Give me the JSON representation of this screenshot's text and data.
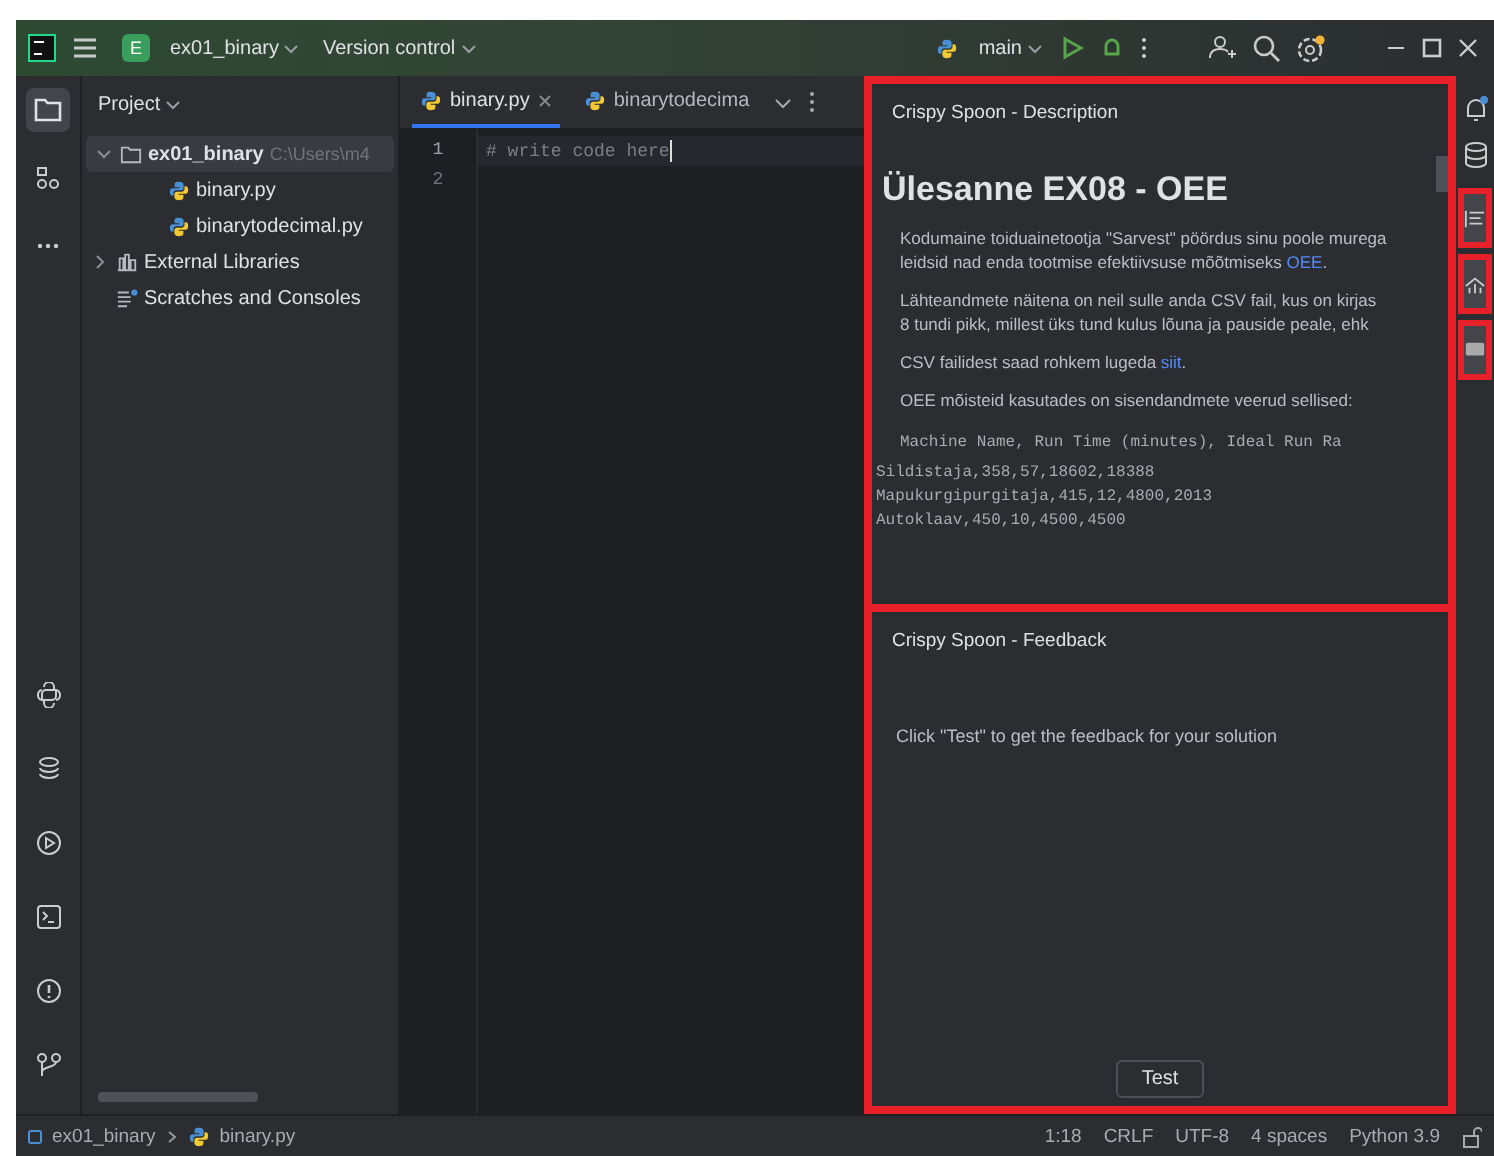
{
  "title_bar": {
    "project_badge": "E",
    "project": "ex01_binary",
    "vcs": "Version control",
    "branch": "main"
  },
  "project_panel": {
    "title": "Project",
    "tree": [
      {
        "label": "ex01_binary",
        "path": "C:\\Users\\m4",
        "kind": "folder",
        "expanded": true,
        "selected": true,
        "children": [
          {
            "label": "binary.py",
            "kind": "python",
            "selected": false
          },
          {
            "label": "binarytodecimal.py",
            "kind": "python",
            "selected": false
          }
        ]
      },
      {
        "label": "External Libraries",
        "kind": "library",
        "expanded": false,
        "selected": false
      },
      {
        "label": "Scratches and Consoles",
        "kind": "scratch",
        "selected": false
      }
    ]
  },
  "editor": {
    "tabs": [
      {
        "label": "binary.py",
        "selected": true
      },
      {
        "label": "binarytodecima",
        "selected": false
      }
    ],
    "lines": [
      {
        "number": "1",
        "code": "# write code here"
      },
      {
        "number": "2"
      }
    ]
  },
  "description": {
    "title": "Crispy Spoon - Description",
    "heading": "Ülesanne EX08 - OEE",
    "paragraphs": [
      [
        {
          "text": "Kodumaine toiduainetootja \"Sarvest\" pöördus sinu poole murega"
        },
        {
          "text": "leidsid nad enda tootmise efektiivsuse mõõtmiseks ",
          "link": "OEE",
          "after": "."
        }
      ],
      [
        {
          "text": "Lähteandmete näitena on neil sulle anda CSV fail, kus on kirjas"
        },
        {
          "text": "8 tundi pikk, millest üks tund kulus lõuna ja pauside peale, ehk"
        }
      ],
      [
        {
          "text": "CSV failidest saad rohkem lugeda ",
          "link": "siit",
          "after": "."
        }
      ],
      [
        {
          "text": "OEE mõisteid kasutades on sisendandmete veerud sellised:"
        }
      ]
    ],
    "code_header": "Machine Name, Run Time (minutes), Ideal Run Ra",
    "code_rows": [
      "Sildistaja,358,57,18602,18388",
      "Mapukurgipurgitaja,415,12,4800,2013",
      "Autoklaav,450,10,4500,4500"
    ]
  },
  "feedback": {
    "title": "Crispy Spoon - Feedback",
    "message": "Click \"Test\" to get the feedback for your solution",
    "button": "Test"
  },
  "status_bar": {
    "breadcrumbs": [
      "ex01_binary",
      "binary.py"
    ],
    "items": [
      "1:18",
      "CRLF",
      "UTF-8",
      "4 spaces",
      "Python 3.9"
    ]
  }
}
